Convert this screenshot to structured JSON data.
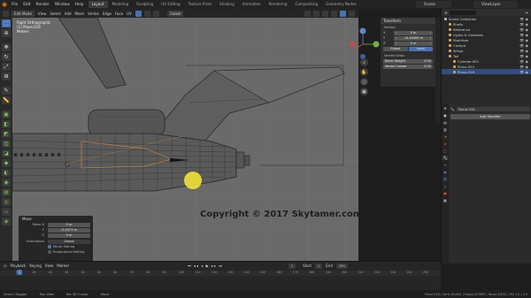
{
  "topbar": {
    "menus": [
      "File",
      "Edit",
      "Render",
      "Window",
      "Help"
    ],
    "workspaces": [
      "Layout",
      "Modeling",
      "Sculpting",
      "UV Editing",
      "Texture Paint",
      "Shading",
      "Animation",
      "Rendering",
      "Compositing",
      "Geometry Nodes"
    ],
    "active_workspace_index": 0,
    "scene": "Scene",
    "view_layer": "ViewLayer"
  },
  "viewport_header": {
    "mode": "Edit Mode",
    "menus": [
      "View",
      "Select",
      "Add",
      "Mesh",
      "Vertex",
      "Edge",
      "Face",
      "UV"
    ],
    "orientation": "Global"
  },
  "viewport": {
    "view_name": "Right Orthographic",
    "object_name": "(1) Plane.016",
    "units": "Meters",
    "copyright": "Copyright © 2017 Skytamer.com"
  },
  "npanel": {
    "title": "Transform",
    "section_label": "Vertex:",
    "rows": [
      {
        "label": "X",
        "value": "0 m"
      },
      {
        "label": "Y",
        "value": "-14.03469 m"
      },
      {
        "label": "Z",
        "value": "0 m"
      }
    ],
    "seg": [
      "Global",
      "Local"
    ],
    "seg_active": 1,
    "vertex_data_label": "Vertex Data:",
    "vertex_data_rows": [
      {
        "label": "Bevel Weight",
        "value": "0.00"
      },
      {
        "label": "Vertex Crease",
        "value": "0.00"
      }
    ]
  },
  "outliner": {
    "items": [
      {
        "label": "Scene Collection",
        "indent": 0,
        "color": "#bbbbbb",
        "selected": false
      },
      {
        "label": "Shells",
        "indent": 1,
        "color": "#d9a066",
        "selected": false
      },
      {
        "label": "Reference",
        "indent": 1,
        "color": "#d9a066",
        "selected": false
      },
      {
        "label": "Lights & Cameras",
        "indent": 1,
        "color": "#d9a066",
        "selected": false
      },
      {
        "label": "Stabilizer",
        "indent": 1,
        "color": "#d9a066",
        "selected": false
      },
      {
        "label": "Cockpit",
        "indent": 1,
        "color": "#d9a066",
        "selected": false
      },
      {
        "label": "Wings",
        "indent": 1,
        "color": "#d9a066",
        "selected": false
      },
      {
        "label": "Tail",
        "indent": 1,
        "color": "#d9a066",
        "selected": false
      },
      {
        "label": "Cylinder.003",
        "indent": 2,
        "color": "#e09a4a",
        "selected": false
      },
      {
        "label": "Plane.024",
        "indent": 2,
        "color": "#e09a4a",
        "selected": false
      },
      {
        "label": "Plane.016",
        "indent": 2,
        "color": "#e09a4a",
        "selected": true
      }
    ]
  },
  "properties": {
    "object_name": "Plane.016",
    "add_modifier_label": "Add Modifier"
  },
  "redo_panel": {
    "title": "Move",
    "rows": [
      {
        "label": "Move X",
        "value": "0 m"
      },
      {
        "label": "Y",
        "value": "-0.2077 m"
      },
      {
        "label": "Z",
        "value": "0 m"
      }
    ],
    "orientation_label": "Orientation",
    "orientation_value": "Global",
    "checks": [
      {
        "label": "Mirror Editing",
        "on": true
      },
      {
        "label": "Proportional Editing",
        "on": false
      }
    ]
  },
  "timeline": {
    "menus": [
      "Playback",
      "Keying",
      "View",
      "Marker"
    ],
    "current_frame": "1",
    "start_label": "Start",
    "start": "1",
    "end_label": "End",
    "end": "250",
    "ticks": [
      "0",
      "10",
      "20",
      "30",
      "40",
      "50",
      "60",
      "70",
      "80",
      "90",
      "100",
      "110",
      "120",
      "130",
      "140",
      "150",
      "160",
      "170",
      "180",
      "190",
      "200",
      "210",
      "220",
      "230",
      "240",
      "250"
    ]
  },
  "statusbar": {
    "items": [
      "Select (Toggle)",
      "Pan View",
      "Set 3D Cursor",
      "Move"
    ],
    "version": "Plane.016 | Verts 61/461 | Edges 87/899 | Faces 0/432 | Tris 1.0 | 3.0"
  },
  "colors": {
    "accent": "#4772b3",
    "viewport_bg": "#6a6a6a",
    "cursor_dot": "#f2e13a",
    "brand": "#e87d0d"
  }
}
